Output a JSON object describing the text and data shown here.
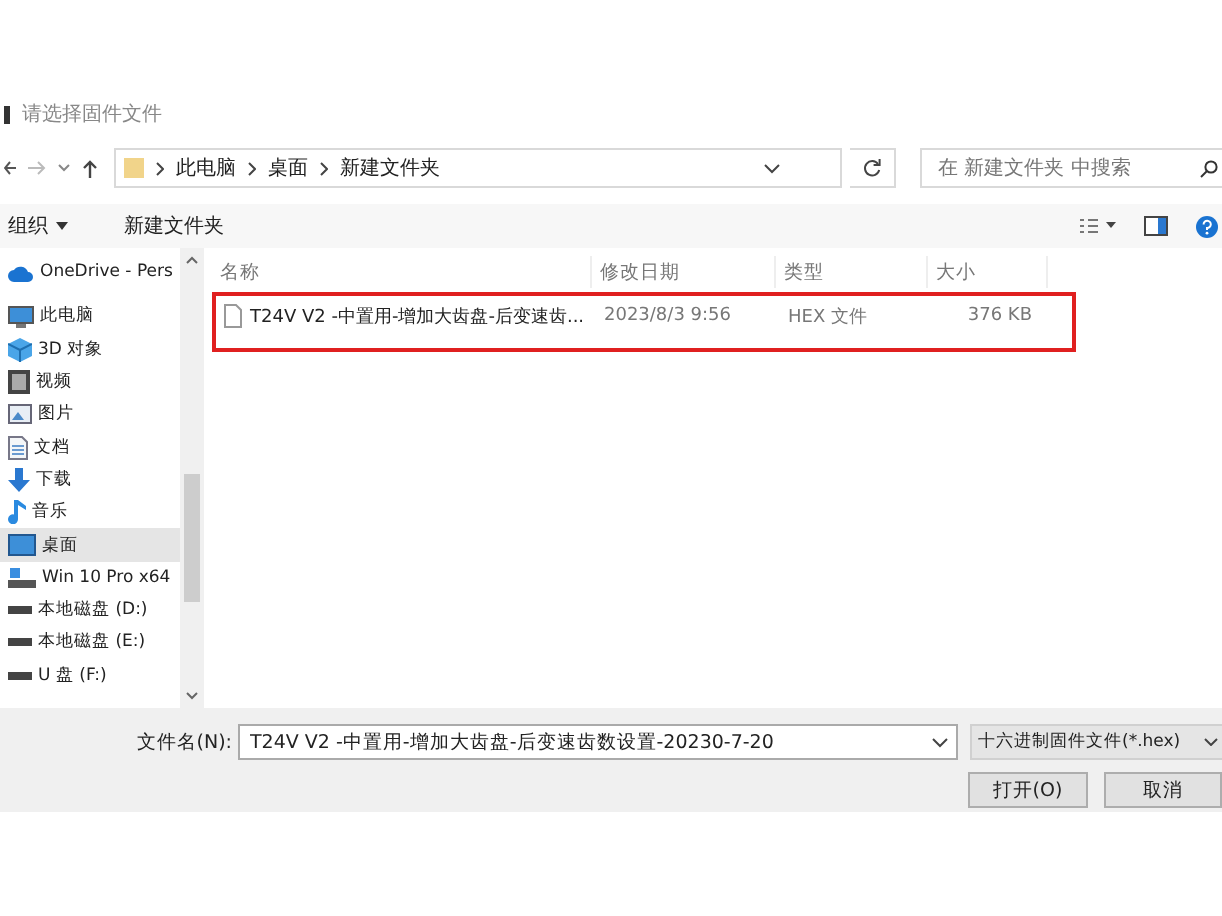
{
  "window": {
    "title": "请选择固件文件"
  },
  "address_bar": {
    "path": [
      "此电脑",
      "桌面",
      "新建文件夹"
    ]
  },
  "search": {
    "placeholder": "在 新建文件夹 中搜索"
  },
  "toolbar": {
    "organize": "组织",
    "new_folder": "新建文件夹"
  },
  "sidebar": {
    "items": [
      {
        "kind": "cloud",
        "label": "OneDrive - Pers",
        "selected": false
      },
      {
        "kind": "pc",
        "label": "此电脑",
        "selected": false
      },
      {
        "kind": "cube",
        "label": "3D 对象",
        "selected": false
      },
      {
        "kind": "film",
        "label": "视频",
        "selected": false
      },
      {
        "kind": "picture",
        "label": "图片",
        "selected": false
      },
      {
        "kind": "doc",
        "label": "文档",
        "selected": false
      },
      {
        "kind": "download",
        "label": "下载",
        "selected": false
      },
      {
        "kind": "music",
        "label": "音乐",
        "selected": false
      },
      {
        "kind": "desktop",
        "label": "桌面",
        "selected": true
      },
      {
        "kind": "windrive",
        "label": "Win 10 Pro x64",
        "selected": false
      },
      {
        "kind": "drive",
        "label": "本地磁盘 (D:)",
        "selected": false
      },
      {
        "kind": "drive",
        "label": "本地磁盘 (E:)",
        "selected": false
      },
      {
        "kind": "drive",
        "label": "U 盘 (F:)",
        "selected": false
      }
    ]
  },
  "table": {
    "columns": [
      "名称",
      "修改日期",
      "类型",
      "大小"
    ],
    "rows": [
      {
        "cells": [
          "T24V V2 -中置用-增加大齿盘-后变速齿...",
          "2023/8/3 9:56",
          "HEX 文件",
          "376 KB"
        ],
        "highlighted": true
      }
    ]
  },
  "footer": {
    "filename_label": "文件名(N):",
    "filename": "T24V V2 -中置用-增加大齿盘-后变速齿数设置-20230-7-20",
    "filter": "十六进制固件文件(*.hex)",
    "buttons": [
      "打开(O)",
      "取消"
    ]
  }
}
